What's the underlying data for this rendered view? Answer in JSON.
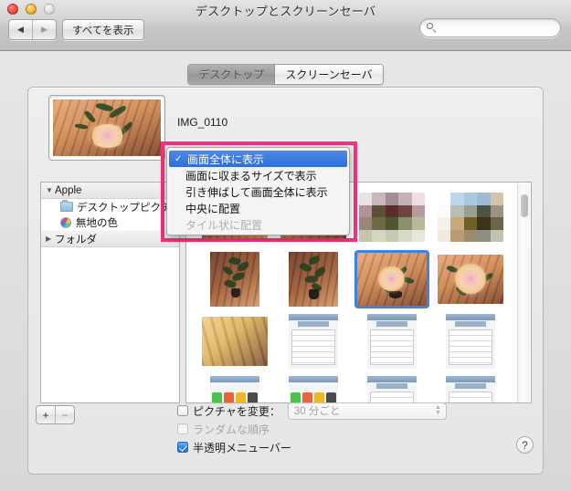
{
  "window": {
    "title": "デスクトップとスクリーンセーバ",
    "traffic_lights": [
      "close",
      "minimize",
      "zoom"
    ]
  },
  "toolbar": {
    "back_icon": "◀",
    "forward_icon": "▶",
    "show_all_label": "すべてを表示",
    "search_placeholder": "",
    "search_value": "",
    "search_icon": "search-icon"
  },
  "tabs": [
    {
      "label": "デスクトップ",
      "active": false
    },
    {
      "label": "スクリーンセーバ",
      "active": true
    }
  ],
  "preview": {
    "image_name": "IMG_0110"
  },
  "sources": [
    {
      "label": "Apple",
      "type": "group",
      "disclosure": "▼"
    },
    {
      "label": "デスクトップピクチ…",
      "type": "child",
      "icon": "folder-icon"
    },
    {
      "label": "無地の色",
      "type": "child",
      "icon": "color-wheel-icon"
    },
    {
      "label": "フォルダ",
      "type": "group",
      "disclosure": "▶"
    }
  ],
  "scale_menu": {
    "open": true,
    "items": [
      {
        "label": "画面全体に表示",
        "checked": true,
        "selected": true,
        "disabled": false
      },
      {
        "label": "画面に収まるサイズで表示",
        "checked": false,
        "selected": false,
        "disabled": false
      },
      {
        "label": "引き伸ばして画面全体に表示",
        "checked": false,
        "selected": false,
        "disabled": false
      },
      {
        "label": "中央に配置",
        "checked": false,
        "selected": false,
        "disabled": false
      },
      {
        "label": "タイル状に配置",
        "checked": false,
        "selected": false,
        "disabled": true
      }
    ],
    "checkmark": "✓",
    "annotation_color": "#f5337e"
  },
  "grid": {
    "selected_index": 6,
    "scrollbar_position": "near-top"
  },
  "bottom": {
    "add_label": "+",
    "remove_label": "−",
    "change_picture_label": "ピクチャを変更：",
    "change_picture_checked": false,
    "interval_value": "30 分ごと",
    "interval_enabled": false,
    "random_order_label": "ランダムな順序",
    "random_order_checked": false,
    "random_order_enabled": false,
    "translucent_menubar_label": "半透明メニューバー",
    "translucent_menubar_checked": true,
    "help_label": "?"
  },
  "colors": {
    "accent_blue": "#2f7fe0",
    "selection_blue": "#3f82e2",
    "annotation_pink": "#f5337e",
    "window_bg": "#ececec"
  }
}
